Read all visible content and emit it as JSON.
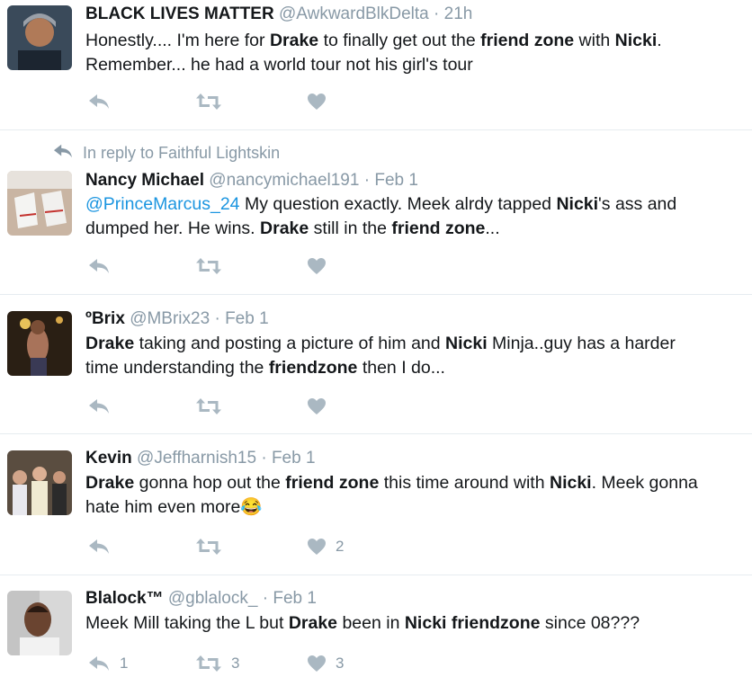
{
  "tweets": [
    {
      "name": "BLACK LIVES MATTER",
      "handle": "@AwkwardBlkDelta",
      "sep": "·",
      "time": "21h",
      "in_reply_to": "",
      "lines": [
        [
          {
            "t": "Honestly.... I'm here for "
          },
          {
            "t": "Drake",
            "b": true
          },
          {
            "t": " to finally get out the "
          },
          {
            "t": "friend zone",
            "b": true
          },
          {
            "t": " with "
          },
          {
            "t": "Nicki",
            "b": true
          },
          {
            "t": "."
          }
        ],
        [
          {
            "t": "Remember... he had a world tour not his girl's tour"
          }
        ]
      ],
      "reply_count": "",
      "retweet_count": "",
      "like_count": ""
    },
    {
      "name": "Nancy Michael",
      "handle": "@nancymichael191",
      "sep": "·",
      "time": "Feb 1",
      "in_reply_to": "In reply to Faithful Lightskin",
      "lines": [
        [
          {
            "t": "@PrinceMarcus_24",
            "m": true
          },
          {
            "t": " My question exactly. Meek alrdy tapped "
          },
          {
            "t": "Nicki",
            "b": true
          },
          {
            "t": "'s ass and"
          }
        ],
        [
          {
            "t": "dumped her. He wins. "
          },
          {
            "t": "Drake",
            "b": true
          },
          {
            "t": " still in the "
          },
          {
            "t": "friend zone",
            "b": true
          },
          {
            "t": "..."
          }
        ]
      ],
      "reply_count": "",
      "retweet_count": "",
      "like_count": ""
    },
    {
      "name": "ºBrix",
      "handle": "@MBrix23",
      "sep": "·",
      "time": "Feb 1",
      "in_reply_to": "",
      "lines": [
        [
          {
            "t": "Drake",
            "b": true
          },
          {
            "t": " taking and posting a picture of him and "
          },
          {
            "t": "Nicki",
            "b": true
          },
          {
            "t": " Minja..guy has a harder"
          }
        ],
        [
          {
            "t": "time understanding the "
          },
          {
            "t": "friendzone",
            "b": true
          },
          {
            "t": " then I do..."
          }
        ]
      ],
      "reply_count": "",
      "retweet_count": "",
      "like_count": ""
    },
    {
      "name": "Kevin",
      "handle": "@Jeffharnish15",
      "sep": "·",
      "time": "Feb 1",
      "in_reply_to": "",
      "lines": [
        [
          {
            "t": "Drake",
            "b": true
          },
          {
            "t": " gonna hop out the "
          },
          {
            "t": "friend zone",
            "b": true
          },
          {
            "t": " this time around with "
          },
          {
            "t": "Nicki",
            "b": true
          },
          {
            "t": ". Meek gonna"
          }
        ],
        [
          {
            "t": "hate him even more😂"
          }
        ]
      ],
      "reply_count": "",
      "retweet_count": "",
      "like_count": "2"
    },
    {
      "name": "Blalock™",
      "handle": "@gblalock_",
      "sep": "·",
      "time": "Feb 1",
      "in_reply_to": "",
      "lines": [
        [
          {
            "t": "Meek Mill taking the L but "
          },
          {
            "t": "Drake",
            "b": true
          },
          {
            "t": " been in "
          },
          {
            "t": "Nicki friendzone",
            "b": true
          },
          {
            "t": " since 08???"
          }
        ]
      ],
      "reply_count": "1",
      "retweet_count": "3",
      "like_count": "3"
    }
  ],
  "icons": {
    "reply": "reply-icon",
    "retweet": "retweet-icon",
    "like": "heart-icon",
    "reply_context": "reply-arrow-icon"
  },
  "colors": {
    "text": "#14171a",
    "muted": "#8899a6",
    "icon": "#aab8c2",
    "link": "#1b95e0",
    "divider": "#e6ecf0"
  }
}
